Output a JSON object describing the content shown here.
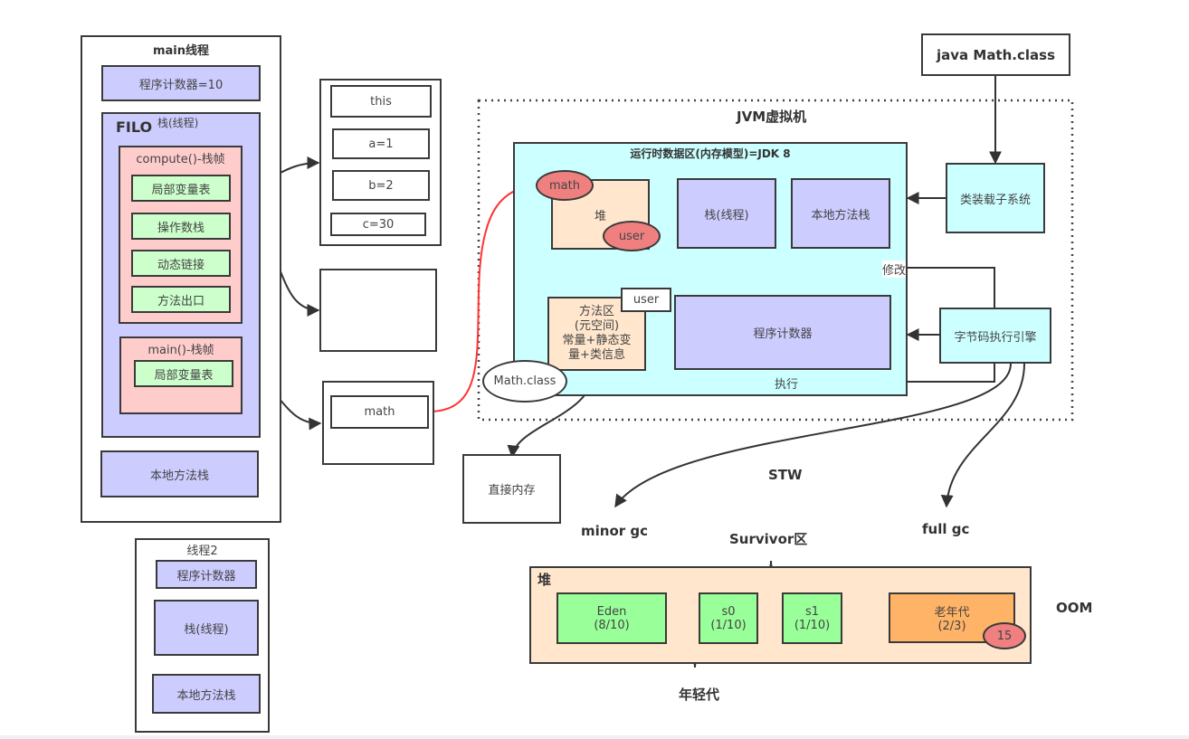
{
  "main_thread": {
    "title": "main线程",
    "pc": "程序计数器=10",
    "stack_label_bold": "FILO",
    "stack_label": "栈(线程)",
    "compute_frame": {
      "title": "compute()-栈帧",
      "items": [
        "局部变量表",
        "操作数栈",
        "动态链接",
        "方法出口"
      ]
    },
    "main_frame": {
      "title": "main()-栈帧",
      "items": [
        "局部变量表"
      ]
    },
    "native_stack": "本地方法栈"
  },
  "thread2": {
    "title": "线程2",
    "pc": "程序计数器",
    "stack": "栈(线程)",
    "native_stack": "本地方法栈"
  },
  "locals_box": {
    "items": [
      "this",
      "a=1",
      "b=2",
      "c=30"
    ]
  },
  "main_locals_box": {
    "items": [
      "math"
    ]
  },
  "direct_memory": "直接内存",
  "class_file": "java Math.class",
  "jvm": {
    "title": "JVM虚拟机",
    "runtime_area": {
      "title": "运行时数据区(内存模型)=JDK 8",
      "heap": "堆",
      "heap_objects": [
        "math",
        "user"
      ],
      "stack": "栈(线程)",
      "native_stack": "本地方法栈",
      "method_area": [
        "方法区",
        "(元空间)",
        "常量+静态变",
        "量+类信息"
      ],
      "user_tag": "user",
      "pc": "程序计数器",
      "math_class": "Math.class"
    },
    "class_loader": "类装载子系统",
    "exec_engine": "字节码执行引擎",
    "edge_labels": {
      "modify": "修改",
      "execute": "执行"
    }
  },
  "gc": {
    "stw": "STW",
    "minor": "minor gc",
    "full": "full gc",
    "survivor_label": "Survivor区",
    "young_label": "年轻代",
    "oom": "OOM",
    "heap": {
      "title": "堆",
      "eden": {
        "name": "Eden",
        "ratio": "(8/10)"
      },
      "s0": {
        "name": "s0",
        "ratio": "(1/10)"
      },
      "s1": {
        "name": "s1",
        "ratio": "(1/10)"
      },
      "old": {
        "name": "老年代",
        "ratio": "(2/3)"
      },
      "age_threshold": "15"
    }
  }
}
